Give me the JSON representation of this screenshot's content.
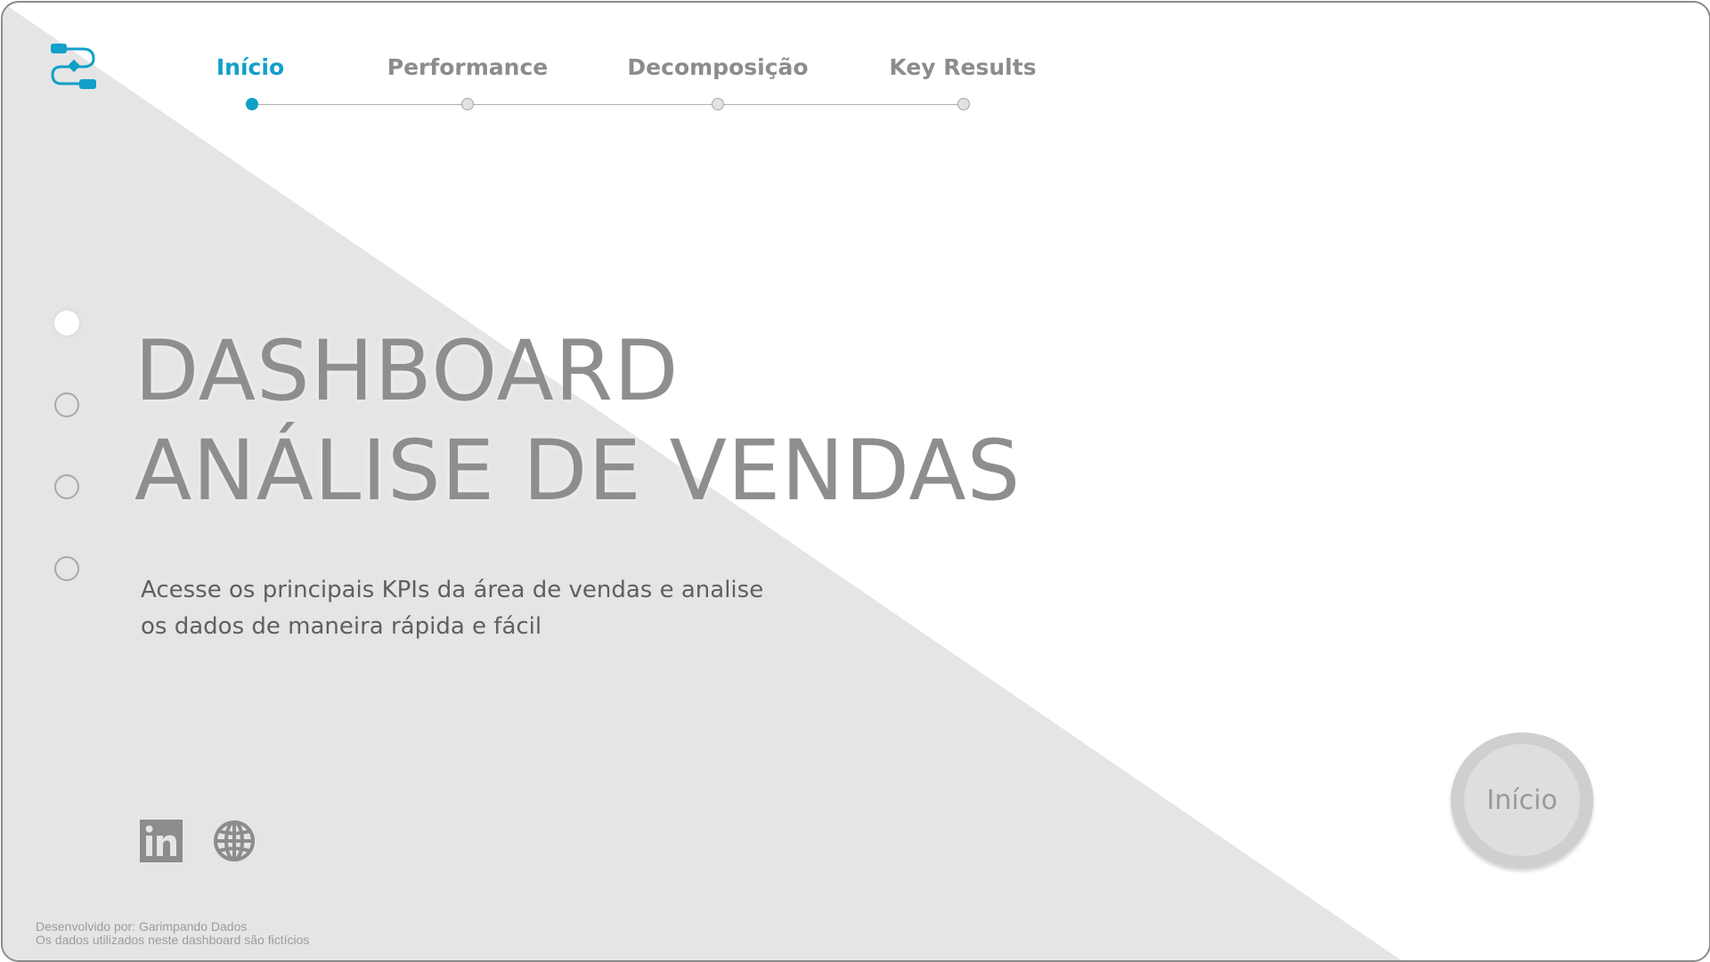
{
  "colors": {
    "accent": "#11a0c8",
    "background_shape": "#e5e5e5",
    "text_muted": "#8c8c8c"
  },
  "nav": {
    "items": [
      {
        "label": "Início",
        "active": true
      },
      {
        "label": "Performance",
        "active": false
      },
      {
        "label": "Decomposição",
        "active": false
      },
      {
        "label": "Key Results",
        "active": false
      }
    ]
  },
  "hero": {
    "title_line1": "DASHBOARD",
    "title_line2": "ANÁLISE DE VENDAS",
    "subtitle_line1": "Acesse os principais KPIs da área de vendas e analise",
    "subtitle_line2": "os dados de maneira rápida e fácil"
  },
  "side_nav": {
    "count": 4,
    "active_index": 0
  },
  "social": [
    {
      "icon": "linkedin-icon"
    },
    {
      "icon": "globe-icon"
    }
  ],
  "start_button": {
    "label": "Início"
  },
  "footer": {
    "line1": "Desenvolvido por: Garimpando Dados",
    "line2": "Os dados utilizados neste dashboard são fictícios"
  }
}
